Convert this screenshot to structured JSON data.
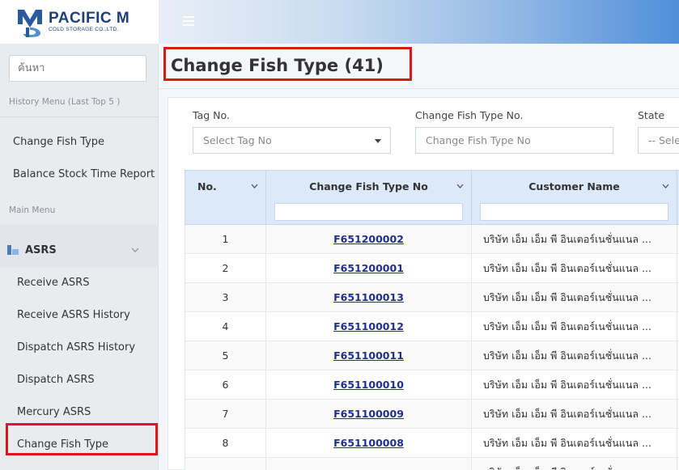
{
  "brand": {
    "name": "PACIFIC M",
    "subtitle": "COLD STORAGE CO.,LTD."
  },
  "search": {
    "placeholder": "ค้นหา"
  },
  "sidebar": {
    "history_label": "History Menu (Last Top 5 )",
    "history_items": [
      "Change Fish Type",
      "Balance Stock Time Report"
    ],
    "main_label": "Main Menu",
    "group": {
      "label": "ASRS"
    },
    "sub_items": [
      "Receive ASRS",
      "Receive ASRS History",
      "Dispatch ASRS History",
      "Dispatch ASRS",
      "Mercury ASRS",
      "Change Fish Type"
    ]
  },
  "page": {
    "title": "Change Fish Type (41)"
  },
  "filters": {
    "tag_no": {
      "label": "Tag No.",
      "placeholder": "Select Tag No"
    },
    "change_no": {
      "label": "Change Fish Type No.",
      "placeholder": "Change Fish Type No"
    },
    "state": {
      "label": "State",
      "placeholder": "-- Selec"
    }
  },
  "table": {
    "columns": [
      "No.",
      "Change Fish Type No",
      "Customer Name"
    ],
    "rows": [
      {
        "no": "1",
        "code": "F651200002",
        "customer": "บริษัท เอ็ม เอ็ม พี อินเตอร์เนชั่นแนล ..."
      },
      {
        "no": "2",
        "code": "F651200001",
        "customer": "บริษัท เอ็ม เอ็ม พี อินเตอร์เนชั่นแนล ..."
      },
      {
        "no": "3",
        "code": "F651100013",
        "customer": "บริษัท เอ็ม เอ็ม พี อินเตอร์เนชั่นแนล ..."
      },
      {
        "no": "4",
        "code": "F651100012",
        "customer": "บริษัท เอ็ม เอ็ม พี อินเตอร์เนชั่นแนล ..."
      },
      {
        "no": "5",
        "code": "F651100011",
        "customer": "บริษัท เอ็ม เอ็ม พี อินเตอร์เนชั่นแนล ..."
      },
      {
        "no": "6",
        "code": "F651100010",
        "customer": "บริษัท เอ็ม เอ็ม พี อินเตอร์เนชั่นแนล ..."
      },
      {
        "no": "7",
        "code": "F651100009",
        "customer": "บริษัท เอ็ม เอ็ม พี อินเตอร์เนชั่นแนล ..."
      },
      {
        "no": "8",
        "code": "F651100008",
        "customer": "บริษัท เอ็ม เอ็ม พี อินเตอร์เนชั่นแนล ..."
      },
      {
        "no": "",
        "code": "",
        "customer": "บริษัท เอ็ม เอ็ม พี อินเตอร์เนชั่นแนล ..."
      }
    ]
  },
  "colors": {
    "highlight": "#d61a1a",
    "link": "#1f2f8f",
    "header_bg": "#dbe9f8"
  },
  "icons": {
    "menu": "hamburger-icon",
    "group": "warehouse-icon",
    "collapse": "chevron-down-icon",
    "dropdown": "caret-down-icon"
  }
}
